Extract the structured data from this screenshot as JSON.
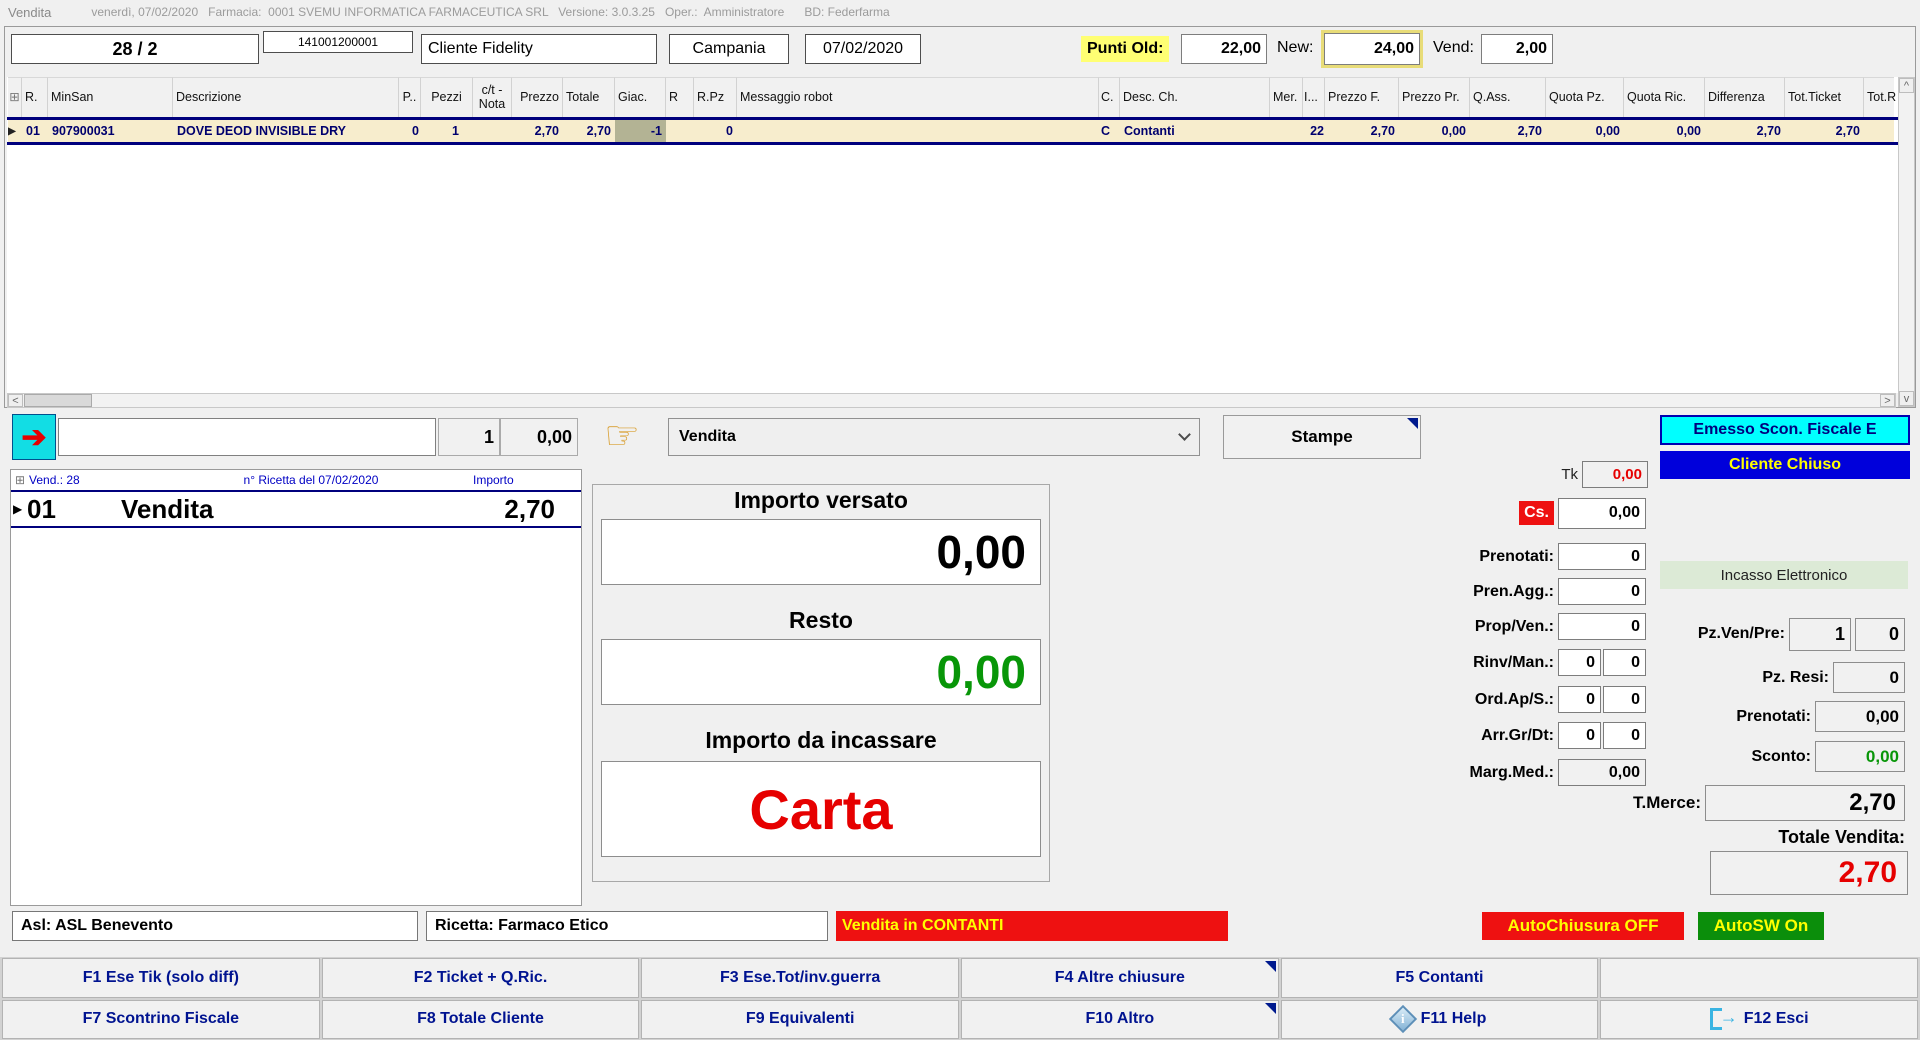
{
  "titlebar": {
    "app": "Vendita",
    "info": "venerdì, 07/02/2020   Farmacia:  0001 SVEMU INFORMATICA FARMACEUTICA SRL   Versione: 3.0.3.25   Oper.:  Amministratore      BD: Federfarma"
  },
  "header": {
    "sale_number": "28 / 2",
    "code": "141001200001",
    "client": "Cliente Fidelity",
    "region": "Campania",
    "date": "07/02/2020",
    "punti_old_label": "Punti Old:",
    "punti_old": "22,00",
    "new_label": "New:",
    "punti_new": "24,00",
    "vend_label": "Vend:",
    "punti_vend": "2,00"
  },
  "grid": {
    "columns": [
      "⊞",
      "R.",
      "MinSan",
      "Descrizione",
      "P..",
      "Pezzi",
      "c/t - Nota",
      "Prezzo",
      "Totale",
      "Giac.",
      "R",
      "R.Pz",
      "Messaggio robot",
      "C.",
      "Desc. Ch.",
      "Mer.",
      "I...",
      "Prezzo F.",
      "Prezzo Pr.",
      "Q.Ass.",
      "Quota Pz.",
      "Quota Ric.",
      "Differenza",
      "Tot.Ticket",
      "Tot.R"
    ],
    "row": [
      "▶",
      "01",
      "907900031",
      "DOVE DEOD INVISIBLE DRY",
      "0",
      "1",
      "",
      "2,70",
      "2,70",
      "-1",
      "",
      "0",
      "",
      "C",
      "Contanti",
      "",
      "22",
      "2,70",
      "0,00",
      "2,70",
      "0,00",
      "0,00",
      "2,70",
      "2,70",
      ""
    ]
  },
  "scroll": {
    "up": "^",
    "down": "v",
    "left": "<",
    "right": ">"
  },
  "controls": {
    "enter_icon": "➔",
    "input_value": "",
    "qty": "1",
    "amount": "0,00",
    "hand_icon": "☞",
    "dropdown_value": "Vendita",
    "stampe_label": "Stampe",
    "tk_label": "Tk",
    "tk_value": "0,00"
  },
  "status_right": {
    "emesso": "Emesso Scon. Fiscale E",
    "cliente": "Cliente Chiuso",
    "incasso": "Incasso Elettronico"
  },
  "receipt": {
    "expand": "⊞",
    "vend": "Vend.: 28",
    "ricetta": "n° Ricetta del 07/02/2020",
    "importo": "Importo",
    "marker": "▶",
    "row_num": "01",
    "row_desc": "Vendita",
    "row_amount": "2,70"
  },
  "payment": {
    "versato_label": "Importo versato",
    "versato": "0,00",
    "resto_label": "Resto",
    "resto": "0,00",
    "incassare_label": "Importo da incassare",
    "incassare": "Carta"
  },
  "fields_left": {
    "cs_label": "Cs.",
    "cs": "0,00",
    "prenotati_label": "Prenotati:",
    "prenotati": "0",
    "pren_agg_label": "Pren.Agg.:",
    "pren_agg": "0",
    "prop_ven_label": "Prop/Ven.:",
    "prop_ven": "0",
    "rinv_label": "Rinv/Man.:",
    "rinv1": "0",
    "rinv2": "0",
    "ord_label": "Ord.Ap/S.:",
    "ord1": "0",
    "ord2": "0",
    "arr_label": "Arr.Gr/Dt:",
    "arr1": "0",
    "arr2": "0",
    "marg_label": "Marg.Med.:",
    "marg": "0,00"
  },
  "fields_right": {
    "pz_ven_label": "Pz.Ven/Pre:",
    "pz_ven1": "1",
    "pz_ven2": "0",
    "pz_resi_label": "Pz. Resi:",
    "pz_resi": "0",
    "prenotati_label": "Prenotati:",
    "prenotati": "0,00",
    "sconto_label": "Sconto:",
    "sconto": "0,00",
    "tmerce_label": "T.Merce:",
    "tmerce": "2,70",
    "totale_label": "Totale Vendita:",
    "totale": "2,70"
  },
  "statusbar": {
    "asl": "Asl: ASL Benevento",
    "ricetta": "Ricetta: Farmaco Etico",
    "vendita_contanti": "Vendita in CONTANTI",
    "autochiusura": "AutoChiusura OFF",
    "autosw": "AutoSW On"
  },
  "fkeys": [
    {
      "label": "F1 Ese Tik (solo diff)"
    },
    {
      "label": "F2 Ticket + Q.Ric."
    },
    {
      "label": "F3 Ese.Tot/inv.guerra"
    },
    {
      "label": "F4 Altre chiusure"
    },
    {
      "label": "F5 Contanti"
    },
    {
      "label": ""
    },
    {
      "label": "F7 Scontrino Fiscale"
    },
    {
      "label": "F8 Totale Cliente"
    },
    {
      "label": "F9 Equivalenti"
    },
    {
      "label": "F10 Altro"
    },
    {
      "label": "F11 Help"
    },
    {
      "label": "F12 Esci"
    }
  ],
  "colors": {
    "navy": "#00007d",
    "cream_row": "#f7edcd",
    "giac_cell": "#b3b394",
    "cyan_status": "#00ffff",
    "blue_status": "#0000db",
    "red": "#ee1111",
    "green": "#0b8e0b",
    "yellow_text": "#ffff00",
    "punti_highlight": "#ffff73",
    "pale_green": "#dcead6",
    "value_red": "#e60000",
    "value_green": "#089608"
  }
}
